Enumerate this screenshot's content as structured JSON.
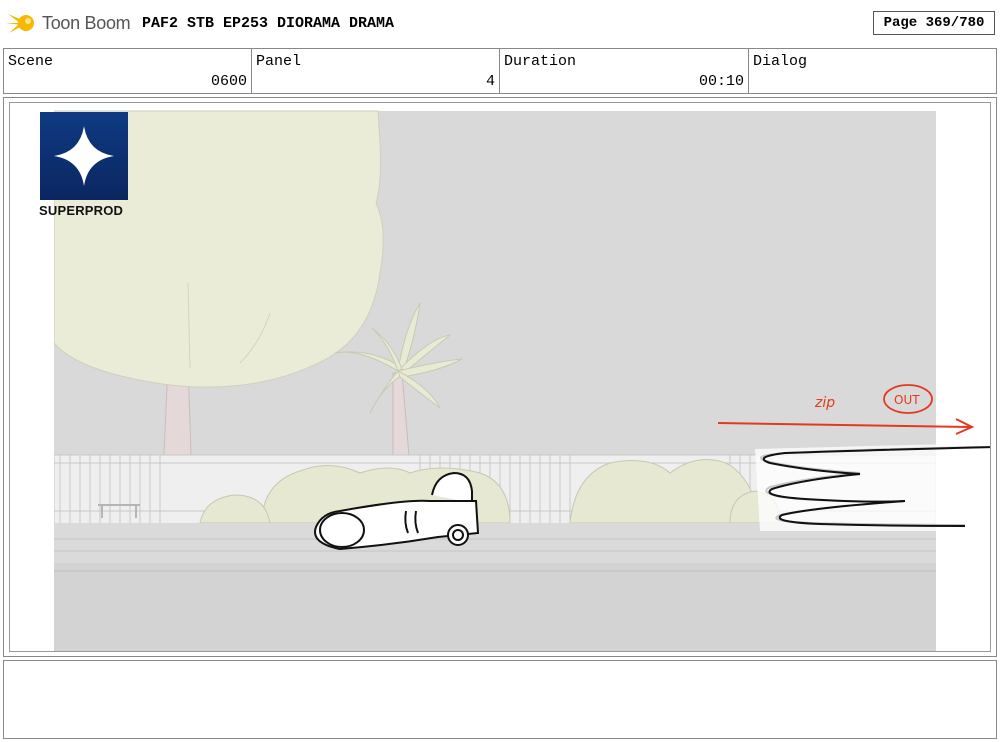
{
  "header": {
    "app_name": "Toon Boom",
    "doc_title": "PAF2 STB EP253 DIORAMA DRAMA",
    "page": "Page 369/780"
  },
  "info": {
    "scene_label": "Scene",
    "scene_value": "0600",
    "panel_label": "Panel",
    "panel_value": "4",
    "duration_label": "Duration",
    "duration_value": "00:10",
    "dialog_label": "Dialog",
    "dialog_value": ""
  },
  "panel": {
    "studio_logo_text": "SUPERPROD",
    "annotations": [
      "zip",
      "OUT"
    ]
  },
  "dialog_text": "",
  "colors": {
    "annotation_red": "#e23a1e",
    "sky_gray": "#d9d9d9",
    "foliage": "#eaecd8",
    "studio_blue": "#0f3a83",
    "logo_yellow": "#f6b800"
  }
}
